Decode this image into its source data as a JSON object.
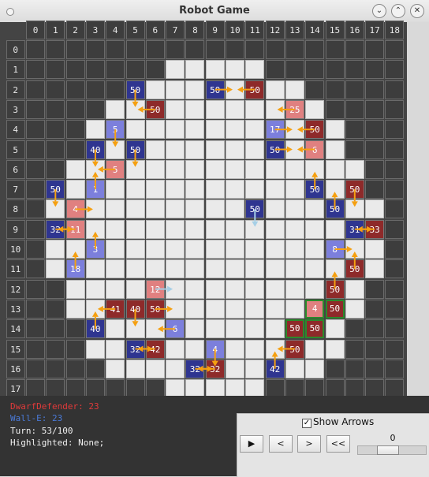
{
  "window": {
    "title": "Robot Game"
  },
  "colors": {
    "red_team": "#e03a3a",
    "blue_team": "#4a7ad8",
    "arrow": "#f5a011",
    "arrow_light": "#a6cfe6"
  },
  "grid": {
    "size": 19,
    "walkable_rows": {
      "1": [
        7,
        11
      ],
      "2": [
        5,
        13
      ],
      "3": [
        4,
        14
      ],
      "4": [
        3,
        15
      ],
      "5": [
        3,
        15
      ],
      "6": [
        2,
        16
      ],
      "7": [
        2,
        16
      ],
      "8": [
        1,
        17
      ],
      "9": [
        1,
        17
      ],
      "10": [
        1,
        17
      ],
      "11": [
        1,
        17
      ],
      "12": [
        2,
        16
      ],
      "13": [
        2,
        16
      ],
      "14": [
        3,
        15
      ],
      "15": [
        3,
        15
      ],
      "16": [
        4,
        14
      ],
      "17": [
        7,
        11
      ]
    }
  },
  "robots": [
    {
      "col": 5,
      "row": 2,
      "hp": "50",
      "team": "blue",
      "shade": "dark"
    },
    {
      "col": 9,
      "row": 2,
      "hp": "50",
      "team": "blue",
      "shade": "dark"
    },
    {
      "col": 11,
      "row": 2,
      "hp": "50",
      "team": "red",
      "shade": "dark"
    },
    {
      "col": 6,
      "row": 3,
      "hp": "50",
      "team": "red",
      "shade": "dark"
    },
    {
      "col": 13,
      "row": 3,
      "hp": "25",
      "team": "red",
      "shade": "light"
    },
    {
      "col": 4,
      "row": 4,
      "hp": "5",
      "team": "blue",
      "shade": "light"
    },
    {
      "col": 12,
      "row": 4,
      "hp": "17",
      "team": "blue",
      "shade": "light"
    },
    {
      "col": 14,
      "row": 4,
      "hp": "50",
      "team": "red",
      "shade": "dark"
    },
    {
      "col": 3,
      "row": 5,
      "hp": "40",
      "team": "blue",
      "shade": "dark"
    },
    {
      "col": 5,
      "row": 5,
      "hp": "50",
      "team": "blue",
      "shade": "dark"
    },
    {
      "col": 12,
      "row": 5,
      "hp": "50",
      "team": "blue",
      "shade": "dark"
    },
    {
      "col": 14,
      "row": 5,
      "hp": "6",
      "team": "red",
      "shade": "light"
    },
    {
      "col": 4,
      "row": 6,
      "hp": "5",
      "team": "red",
      "shade": "light"
    },
    {
      "col": 1,
      "row": 7,
      "hp": "50",
      "team": "blue",
      "shade": "dark"
    },
    {
      "col": 3,
      "row": 7,
      "hp": "1",
      "team": "blue",
      "shade": "light"
    },
    {
      "col": 14,
      "row": 7,
      "hp": "50",
      "team": "blue",
      "shade": "dark"
    },
    {
      "col": 16,
      "row": 7,
      "hp": "50",
      "team": "red",
      "shade": "dark"
    },
    {
      "col": 2,
      "row": 8,
      "hp": "4",
      "team": "red",
      "shade": "light"
    },
    {
      "col": 11,
      "row": 8,
      "hp": "50",
      "team": "blue",
      "shade": "dark"
    },
    {
      "col": 15,
      "row": 8,
      "hp": "50",
      "team": "blue",
      "shade": "dark"
    },
    {
      "col": 1,
      "row": 9,
      "hp": "32",
      "team": "blue",
      "shade": "dark"
    },
    {
      "col": 2,
      "row": 9,
      "hp": "11",
      "team": "red",
      "shade": "light"
    },
    {
      "col": 16,
      "row": 9,
      "hp": "31",
      "team": "blue",
      "shade": "dark"
    },
    {
      "col": 17,
      "row": 9,
      "hp": "33",
      "team": "red",
      "shade": "dark"
    },
    {
      "col": 3,
      "row": 10,
      "hp": "3",
      "team": "blue",
      "shade": "light"
    },
    {
      "col": 15,
      "row": 10,
      "hp": "8",
      "team": "blue",
      "shade": "light"
    },
    {
      "col": 2,
      "row": 11,
      "hp": "18",
      "team": "blue",
      "shade": "light"
    },
    {
      "col": 16,
      "row": 11,
      "hp": "50",
      "team": "red",
      "shade": "dark"
    },
    {
      "col": 6,
      "row": 12,
      "hp": "12",
      "team": "red",
      "shade": "light"
    },
    {
      "col": 15,
      "row": 12,
      "hp": "50",
      "team": "red",
      "shade": "dark"
    },
    {
      "col": 4,
      "row": 13,
      "hp": "41",
      "team": "red",
      "shade": "dark"
    },
    {
      "col": 5,
      "row": 13,
      "hp": "40",
      "team": "red",
      "shade": "dark"
    },
    {
      "col": 6,
      "row": 13,
      "hp": "50",
      "team": "red",
      "shade": "dark"
    },
    {
      "col": 14,
      "row": 13,
      "hp": "4",
      "team": "red",
      "shade": "light",
      "outline": true
    },
    {
      "col": 15,
      "row": 13,
      "hp": "50",
      "team": "red",
      "shade": "dark",
      "outline": true
    },
    {
      "col": 3,
      "row": 14,
      "hp": "40",
      "team": "blue",
      "shade": "dark"
    },
    {
      "col": 7,
      "row": 14,
      "hp": "6",
      "team": "blue",
      "shade": "light"
    },
    {
      "col": 13,
      "row": 14,
      "hp": "50",
      "team": "red",
      "shade": "dark",
      "outline": true
    },
    {
      "col": 14,
      "row": 14,
      "hp": "50",
      "team": "red",
      "shade": "dark",
      "outline": true
    },
    {
      "col": 5,
      "row": 15,
      "hp": "32",
      "team": "blue",
      "shade": "dark"
    },
    {
      "col": 6,
      "row": 15,
      "hp": "42",
      "team": "red",
      "shade": "dark"
    },
    {
      "col": 9,
      "row": 15,
      "hp": "4",
      "team": "blue",
      "shade": "light"
    },
    {
      "col": 13,
      "row": 15,
      "hp": "50",
      "team": "red",
      "shade": "dark"
    },
    {
      "col": 8,
      "row": 16,
      "hp": "32",
      "team": "blue",
      "shade": "dark"
    },
    {
      "col": 9,
      "row": 16,
      "hp": "32",
      "team": "red",
      "shade": "dark"
    },
    {
      "col": 12,
      "row": 16,
      "hp": "42",
      "team": "blue",
      "shade": "dark"
    }
  ],
  "arrows": [
    {
      "from": [
        5,
        2
      ],
      "to": [
        5,
        3
      ]
    },
    {
      "from": [
        9,
        2
      ],
      "to": [
        10,
        2
      ]
    },
    {
      "from": [
        11,
        2
      ],
      "to": [
        10,
        2
      ]
    },
    {
      "from": [
        6,
        3
      ],
      "to": [
        5,
        3
      ]
    },
    {
      "from": [
        13,
        3
      ],
      "to": [
        12,
        3
      ]
    },
    {
      "from": [
        4,
        4
      ],
      "to": [
        4,
        5
      ]
    },
    {
      "from": [
        12,
        4
      ],
      "to": [
        13,
        4
      ]
    },
    {
      "from": [
        14,
        4
      ],
      "to": [
        13,
        4
      ]
    },
    {
      "from": [
        3,
        5
      ],
      "to": [
        3,
        6
      ]
    },
    {
      "from": [
        5,
        5
      ],
      "to": [
        5,
        6
      ]
    },
    {
      "from": [
        12,
        5
      ],
      "to": [
        13,
        5
      ]
    },
    {
      "from": [
        14,
        5
      ],
      "to": [
        13,
        5
      ]
    },
    {
      "from": [
        4,
        6
      ],
      "to": [
        3,
        6
      ]
    },
    {
      "from": [
        1,
        7
      ],
      "to": [
        1,
        8
      ]
    },
    {
      "from": [
        3,
        7
      ],
      "to": [
        3,
        6
      ]
    },
    {
      "from": [
        14,
        7
      ],
      "to": [
        14,
        6
      ]
    },
    {
      "from": [
        16,
        7
      ],
      "to": [
        16,
        8
      ]
    },
    {
      "from": [
        2,
        8
      ],
      "to": [
        3,
        8
      ]
    },
    {
      "from": [
        11,
        8
      ],
      "to": [
        11,
        9
      ],
      "light": true
    },
    {
      "from": [
        15,
        8
      ],
      "to": [
        15,
        7
      ]
    },
    {
      "from": [
        1,
        9
      ],
      "to": [
        2,
        9
      ]
    },
    {
      "from": [
        2,
        9
      ],
      "to": [
        1,
        9
      ]
    },
    {
      "from": [
        16,
        9
      ],
      "to": [
        17,
        9
      ]
    },
    {
      "from": [
        17,
        9
      ],
      "to": [
        16,
        9
      ]
    },
    {
      "from": [
        3,
        10
      ],
      "to": [
        3,
        9
      ]
    },
    {
      "from": [
        15,
        10
      ],
      "to": [
        16,
        10
      ]
    },
    {
      "from": [
        2,
        11
      ],
      "to": [
        2,
        10
      ]
    },
    {
      "from": [
        16,
        11
      ],
      "to": [
        16,
        10
      ]
    },
    {
      "from": [
        6,
        12
      ],
      "to": [
        7,
        12
      ],
      "light": true
    },
    {
      "from": [
        15,
        12
      ],
      "to": [
        15,
        11
      ]
    },
    {
      "from": [
        4,
        13
      ],
      "to": [
        3,
        13
      ]
    },
    {
      "from": [
        5,
        13
      ],
      "to": [
        5,
        14
      ]
    },
    {
      "from": [
        6,
        13
      ],
      "to": [
        7,
        13
      ]
    },
    {
      "from": [
        3,
        14
      ],
      "to": [
        3,
        13
      ]
    },
    {
      "from": [
        7,
        14
      ],
      "to": [
        6,
        14
      ]
    },
    {
      "from": [
        5,
        15
      ],
      "to": [
        6,
        15
      ]
    },
    {
      "from": [
        6,
        15
      ],
      "to": [
        5,
        15
      ]
    },
    {
      "from": [
        9,
        15
      ],
      "to": [
        9,
        16
      ]
    },
    {
      "from": [
        13,
        15
      ],
      "to": [
        12,
        15
      ]
    },
    {
      "from": [
        8,
        16
      ],
      "to": [
        9,
        16
      ]
    },
    {
      "from": [
        9,
        16
      ],
      "to": [
        8,
        16
      ]
    },
    {
      "from": [
        12,
        16
      ],
      "to": [
        12,
        15
      ]
    }
  ],
  "info": {
    "player_red": "DwarfDefender: 23",
    "player_blue": "Wall-E: 23",
    "turn": "Turn: 53/100",
    "highlighted": "Highlighted: None;"
  },
  "controls": {
    "show_arrows_label": "Show Arrows",
    "show_arrows_checked": true,
    "play_label": "▶",
    "prev_label": "<",
    "next_label": ">",
    "rewind_label": "<<",
    "turn_slider_value": "0",
    "turn_slider_fraction": 0.4
  }
}
